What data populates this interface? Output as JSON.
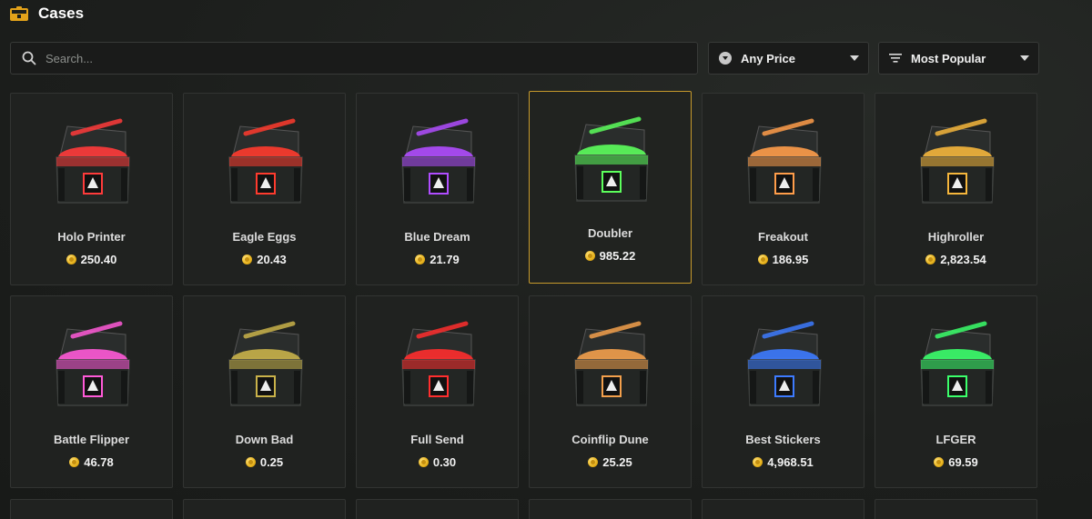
{
  "header": {
    "title": "Cases",
    "icon": "case-icon"
  },
  "search": {
    "placeholder": "Search..."
  },
  "filters": {
    "price": {
      "label": "Any Price",
      "icon": "coin-filter-icon"
    },
    "sort": {
      "label": "Most Popular",
      "icon": "sort-lines-icon"
    }
  },
  "colors": {
    "accent": "#c79a2c",
    "coin": "#e7b21c"
  },
  "cases": [
    {
      "name": "Holo Printer",
      "price": "250.40",
      "color": "#ff3b3b"
    },
    {
      "name": "Eagle Eggs",
      "price": "20.43",
      "color": "#ff3b2e"
    },
    {
      "name": "Blue Dream",
      "price": "21.79",
      "color": "#b04dff"
    },
    {
      "name": "Doubler",
      "price": "985.22",
      "color": "#5cff5c"
    },
    {
      "name": "Freakout",
      "price": "186.95",
      "color": "#ff9d4a"
    },
    {
      "name": "Highroller",
      "price": "2,823.54",
      "color": "#f5b63c"
    },
    {
      "name": "Battle Flipper",
      "price": "46.78",
      "color": "#ff5ad8"
    },
    {
      "name": "Down Bad",
      "price": "0.25",
      "color": "#c9b24a"
    },
    {
      "name": "Full Send",
      "price": "0.30",
      "color": "#ff2e2e"
    },
    {
      "name": "Coinflip Dune",
      "price": "25.25",
      "color": "#f3a04c"
    },
    {
      "name": "Best Stickers",
      "price": "4,968.51",
      "color": "#3d7bff"
    },
    {
      "name": "LFGER",
      "price": "69.59",
      "color": "#3bff6b"
    }
  ]
}
